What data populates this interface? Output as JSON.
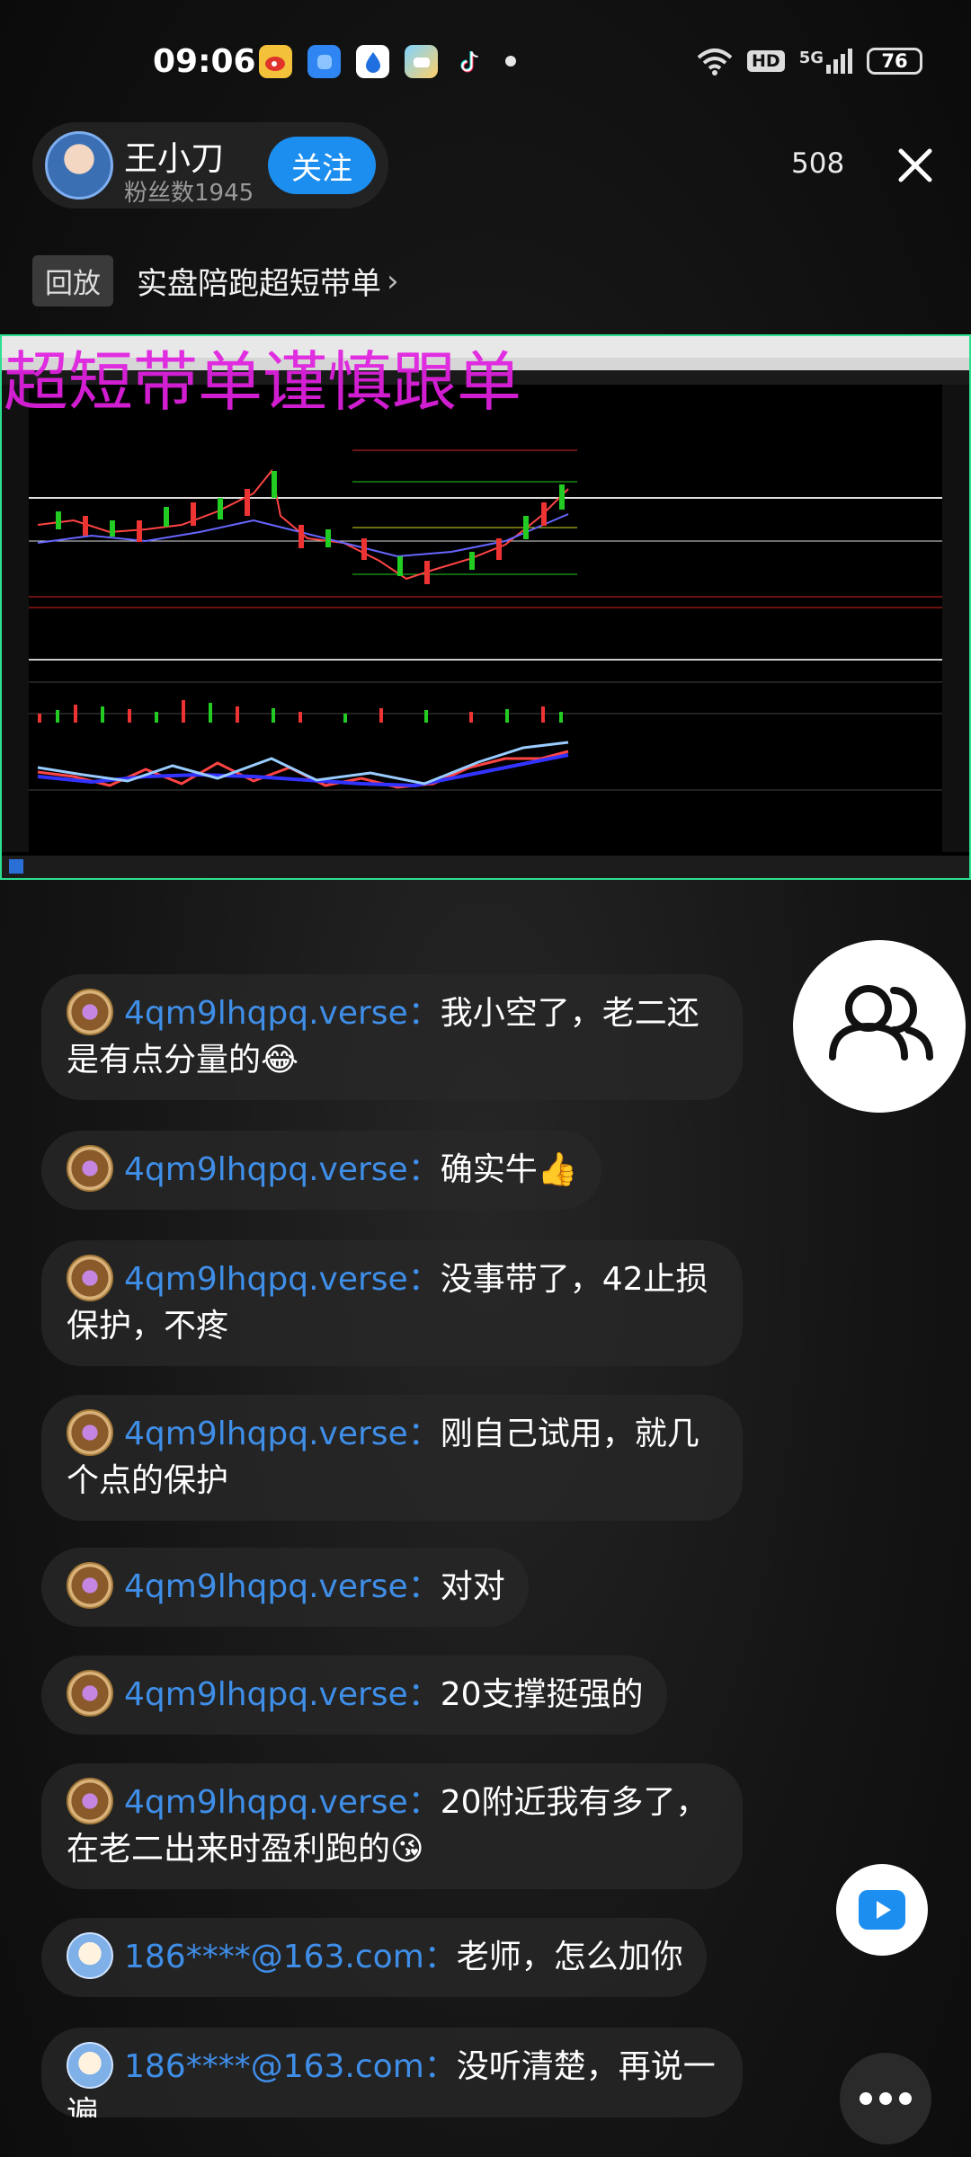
{
  "status_bar": {
    "time": "09:06",
    "hd": "HD",
    "network": "5G",
    "battery": "76",
    "app_icons": [
      "weibo-icon",
      "blue-app-icon",
      "drop-app-icon",
      "cloud-app-icon",
      "tiktok-icon"
    ]
  },
  "host": {
    "name": "王小刀",
    "fans": "粉丝数1945",
    "follow_label": "关注"
  },
  "viewer_count": "508",
  "replay": {
    "tag": "回放",
    "title": "实盘陪跑超短带单",
    "arrow": "›"
  },
  "video": {
    "overlay_title": "超短带单谨慎跟单",
    "accent": "#e020e0",
    "border": "#2be08e"
  },
  "chat": [
    {
      "user": "4qm9lhqpq.verse：",
      "text": "我小空了，老二还是有点分量的😂"
    },
    {
      "user": "4qm9lhqpq.verse：",
      "text": "确实牛👍"
    },
    {
      "user": "4qm9lhqpq.verse：",
      "text": "没事带了，42止损保护，不疼"
    },
    {
      "user": "4qm9lhqpq.verse：",
      "text": "刚自己试用，就几个点的保护"
    },
    {
      "user": "4qm9lhqpq.verse：",
      "text": "对对"
    },
    {
      "user": "4qm9lhqpq.verse：",
      "text": "20支撑挺强的"
    },
    {
      "user": "4qm9lhqpq.verse：",
      "text": "20附近我有多了，在老二出来时盈利跑的😘"
    },
    {
      "user": "186****@163.com：",
      "text": "老师，怎么加你"
    },
    {
      "user": "186****@163.com：",
      "text": "没听清楚，再说一遍"
    }
  ],
  "colors": {
    "username": "#3f8ee8",
    "follow": "#1c8ef0"
  }
}
